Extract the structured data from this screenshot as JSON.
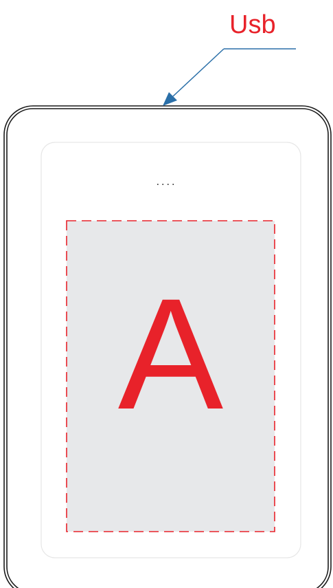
{
  "callout": {
    "label": "Usb"
  },
  "screen": {
    "indicator_text": "...."
  },
  "zone": {
    "letter": "A"
  },
  "colors": {
    "label": "#e8222a",
    "arrow": "#2a6fa8",
    "outline": "#1a1a1a",
    "screen_border": "#e6e6e6",
    "zone_fill": "#e7e8ea",
    "zone_border": "#e8222a"
  },
  "icons": {
    "callout_arrow": "arrow-pointer-icon"
  }
}
